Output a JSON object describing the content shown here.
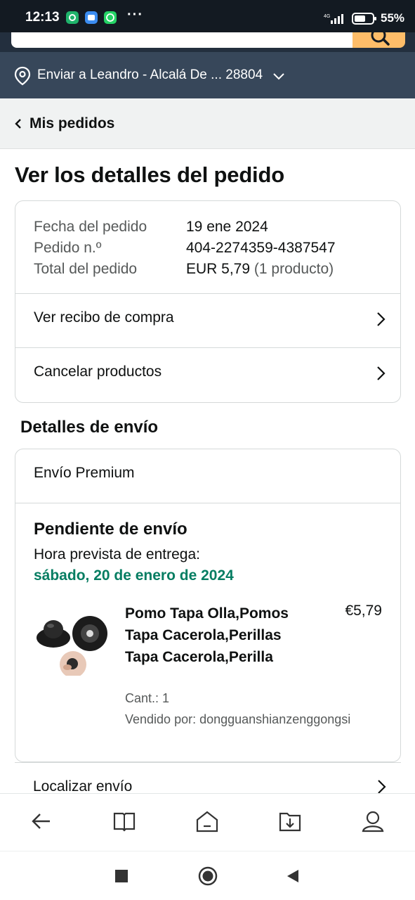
{
  "status_bar": {
    "time": "12:13",
    "more": "···",
    "network": "4G",
    "battery": "55%",
    "app_icons": [
      "app-green-icon",
      "app-blue-icon",
      "whatsapp-icon"
    ]
  },
  "delivery": {
    "label": "Enviar a Leandro - Alcalá De ... 28804"
  },
  "nav": {
    "back_label": "Mis pedidos"
  },
  "page": {
    "title": "Ver los detalles del pedido"
  },
  "order_summary": {
    "date_label": "Fecha del pedido",
    "date_value": "19 ene 2024",
    "number_label": "Pedido n.º",
    "number_value": "404-2274359-4387547",
    "total_label": "Total del pedido",
    "total_value": "EUR 5,79",
    "total_count": "(1 producto)"
  },
  "actions": {
    "receipt": "Ver recibo de compra",
    "cancel": "Cancelar productos"
  },
  "shipping": {
    "section_title": "Detalles de envío",
    "type": "Envío Premium",
    "status": "Pendiente de envío",
    "eta_label": "Hora prevista de entrega:",
    "eta_date": "sábado, 20 de enero de 2024",
    "track_label": "Localizar envío"
  },
  "product": {
    "name": "Pomo Tapa Olla,Pomos Tapa Cacerola,Perillas Tapa Cacerola,Perilla",
    "price": "€5,79",
    "qty": "Cant.: 1",
    "seller": "Vendido por: dongguanshianzenggongsi"
  },
  "bottom_nav": [
    "back-arrow-icon",
    "book-icon",
    "home-icon",
    "download-icon",
    "profile-icon"
  ],
  "system_nav": [
    "recents-square-icon",
    "home-circle-icon",
    "back-triangle-icon"
  ],
  "colors": {
    "header_dark": "#131a22",
    "header_blue": "#37475a",
    "search_button": "#febd69",
    "eta_green": "#067d62"
  }
}
